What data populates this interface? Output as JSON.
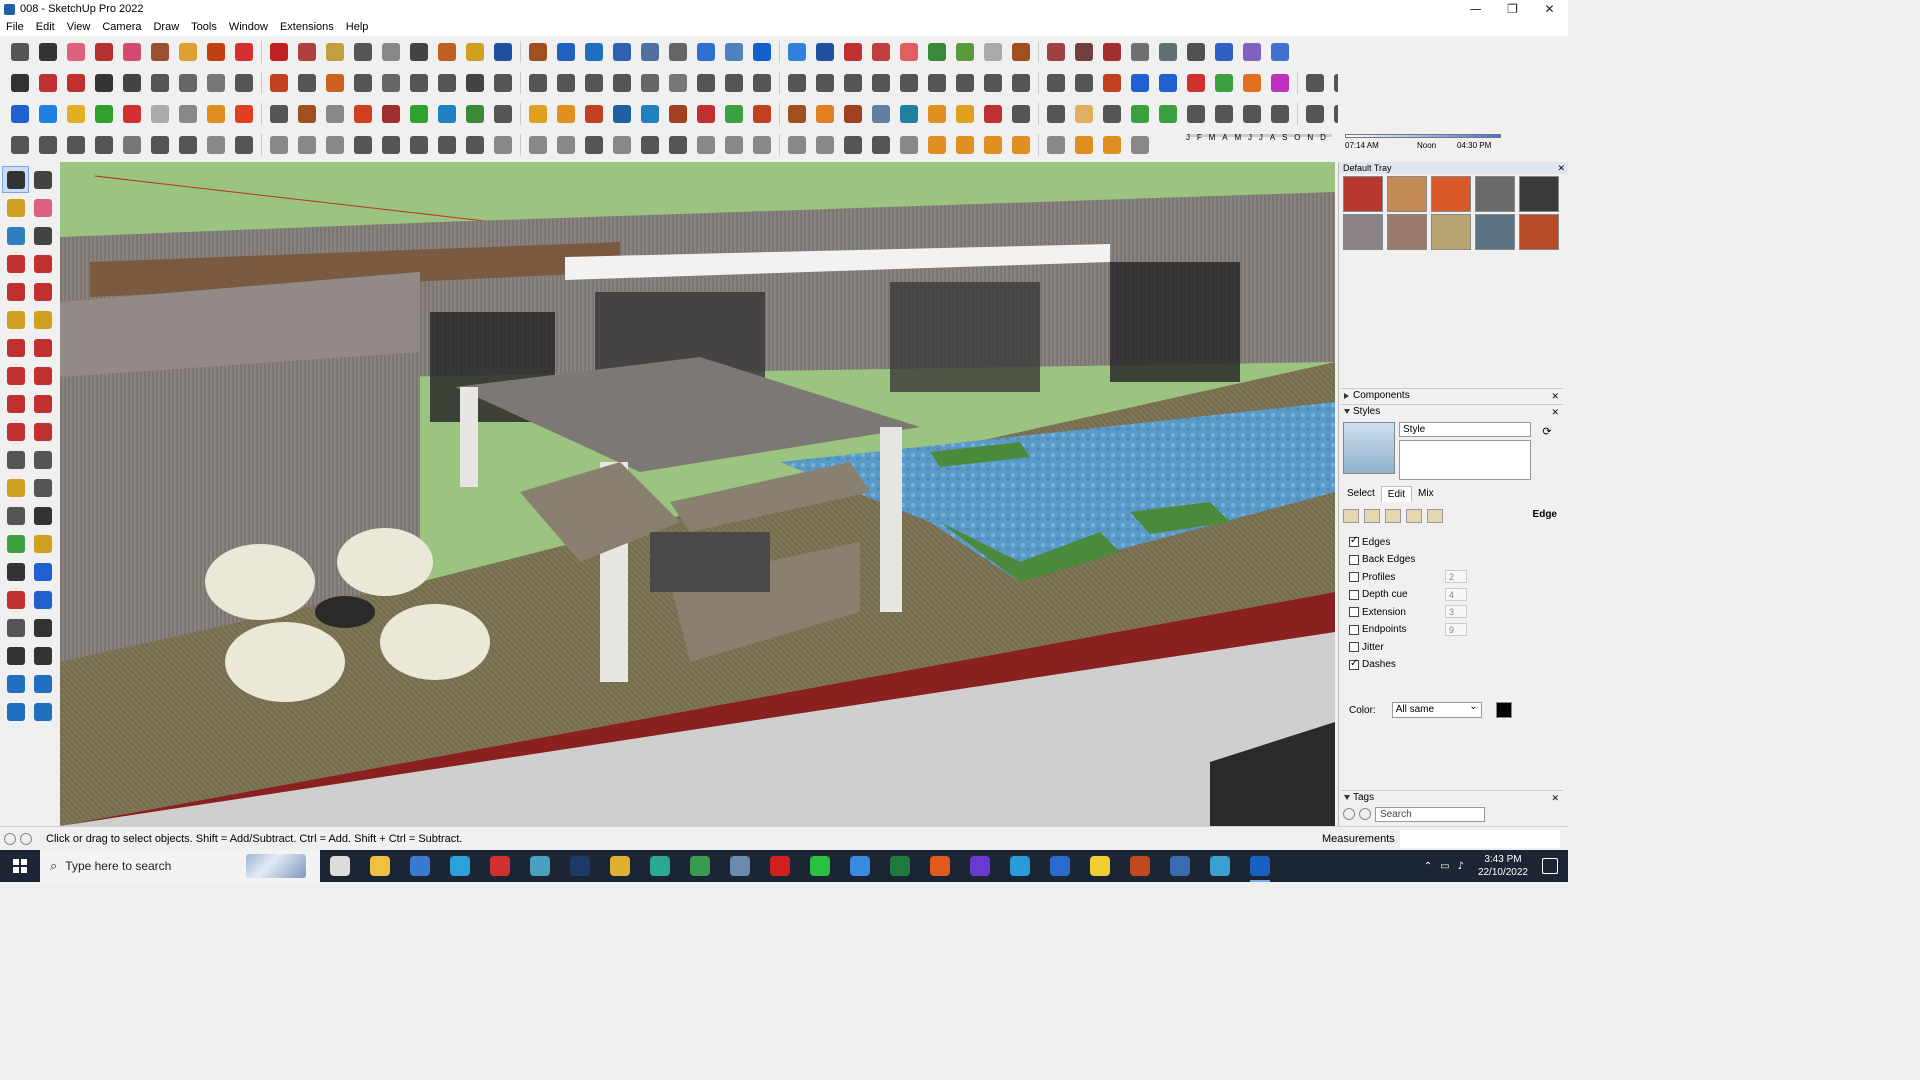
{
  "window": {
    "title": "008 - SketchUp Pro 2022",
    "buttons": [
      "—",
      "❐",
      "✕"
    ]
  },
  "menu": [
    "File",
    "Edit",
    "View",
    "Camera",
    "Draw",
    "Tools",
    "Window",
    "Extensions",
    "Help"
  ],
  "toolbar_icon_colors": {
    "row1": [
      "#555",
      "#333",
      "#e06080",
      "#b43030",
      "#d24a70",
      "#9a5030",
      "#e0a030",
      "#c04010",
      "#d23030",
      "#c02020",
      "#b04040",
      "#c0a040",
      "#555",
      "#888",
      "#444",
      "#c06020",
      "#d0a020",
      "#2050a0",
      "#a05020",
      "#2060c0",
      "#2070c0",
      "#3060b0",
      "#5070a0",
      "#666",
      "#3070d0",
      "#5080c0",
      "#1060d0",
      "#3080e0",
      "#2050a0",
      "#c03030",
      "#c04040",
      "#e06060",
      "#3a8a3a",
      "#5a9a3a",
      "#aaaaaa",
      "#a05020",
      "#a04040",
      "#704040",
      "#a03030",
      "#707070",
      "#607070",
      "#505050",
      "#3060c0",
      "#8060c0",
      "#4070d0"
    ],
    "row2": [
      "#333",
      "#c03030",
      "#c03030",
      "#333",
      "#444",
      "#555",
      "#666",
      "#777",
      "#555",
      "#c04020",
      "#555",
      "#d06020",
      "#555",
      "#666",
      "#555",
      "#555",
      "#444",
      "#555",
      "#555",
      "#555",
      "#555",
      "#555",
      "#666",
      "#777",
      "#555",
      "#555",
      "#555",
      "#555",
      "#555",
      "#555",
      "#555",
      "#555",
      "#555",
      "#555",
      "#555",
      "#555",
      "#555",
      "#555",
      "#c04020",
      "#2060d0",
      "#2060d0",
      "#d03030",
      "#3aa040",
      "#e07020",
      "#c030c0",
      "#555",
      "#555",
      "#333",
      "#555",
      "#555"
    ],
    "row3": [
      "#2060d0",
      "#2080e0",
      "#e0b020",
      "#30a030",
      "#d03030",
      "#aaaaaa",
      "#888",
      "#e09020",
      "#e04020",
      "#555",
      "#a05020",
      "#888",
      "#d04020",
      "#a03030",
      "#30a030",
      "#2080c0",
      "#3a8a3a",
      "#555",
      "#e0a020",
      "#e09020",
      "#c04020",
      "#2060a0",
      "#2080c0",
      "#a04020",
      "#c03030",
      "#3aa040",
      "#c04020",
      "#a05020",
      "#e08020",
      "#a04020",
      "#6080a0",
      "#2080a0",
      "#e09020",
      "#e0a020",
      "#c03030",
      "#555",
      "#555",
      "#e0b060",
      "#555",
      "#3aa040",
      "#3aa040",
      "#555",
      "#555",
      "#555",
      "#555",
      "#555",
      "#555",
      "#2060d0",
      "#555",
      "#e03030",
      "#e060a0"
    ],
    "row4": [
      "#555",
      "#555",
      "#555",
      "#555",
      "#777",
      "#555",
      "#555",
      "#888",
      "#555",
      "#888",
      "#888",
      "#888",
      "#555",
      "#555",
      "#555",
      "#555",
      "#555",
      "#888",
      "#888",
      "#888",
      "#555",
      "#888",
      "#555",
      "#555",
      "#888",
      "#888",
      "#888",
      "#888",
      "#888",
      "#555",
      "#555",
      "#888",
      "#e09020",
      "#e09020",
      "#e09020",
      "#e09020",
      "#888",
      "#e09020",
      "#e09020",
      "#888"
    ]
  },
  "shadow": {
    "months": [
      "J",
      "F",
      "M",
      "A",
      "M",
      "J",
      "J",
      "A",
      "S",
      "O",
      "N",
      "D"
    ],
    "time_start": "07:14 AM",
    "time_mid": "Noon",
    "time_end": "04:30 PM"
  },
  "left_tool_colors": [
    "#333",
    "#444",
    "#d0a020",
    "#e06080",
    "#3080c0",
    "#444",
    "#c03030",
    "#c03030",
    "#c03030",
    "#c03030",
    "#d0a020",
    "#d0a020",
    "#c03030",
    "#c03030",
    "#c03030",
    "#c03030",
    "#c03030",
    "#c03030",
    "#c03030",
    "#c03030",
    "#555",
    "#555",
    "#d0a020",
    "#555",
    "#555",
    "#333",
    "#3aa040",
    "#d0a020",
    "#333",
    "#2060d0",
    "#c03030",
    "#2060d0",
    "#555",
    "#333",
    "#333",
    "#333",
    "#2070c0",
    "#2070c0",
    "#2070c0",
    "#2070c0"
  ],
  "tray": {
    "title": "Default Tray",
    "materials": [
      "#b8382e",
      "#c48a55",
      "#d9582a",
      "#6a6a6a",
      "#3a3a3a",
      "#8a8285",
      "#9a7a6a",
      "#b9a572",
      "#5a7282",
      "#b84a28"
    ],
    "components_label": "Components",
    "styles_label": "Styles",
    "style_name": "Style",
    "tabs": [
      "Select",
      "Edit",
      "Mix"
    ],
    "edit_section": "Edge",
    "checkboxes": [
      {
        "label": "Edges",
        "checked": true,
        "value": ""
      },
      {
        "label": "Back Edges",
        "checked": false,
        "value": ""
      },
      {
        "label": "Profiles",
        "checked": false,
        "value": "2"
      },
      {
        "label": "Depth cue",
        "checked": false,
        "value": "4"
      },
      {
        "label": "Extension",
        "checked": false,
        "value": "3"
      },
      {
        "label": "Endpoints",
        "checked": false,
        "value": "9"
      },
      {
        "label": "Jitter",
        "checked": false,
        "value": ""
      },
      {
        "label": "Dashes",
        "checked": true,
        "value": ""
      }
    ],
    "color_label": "Color:",
    "color_option": "All same",
    "edge_color": "#000000",
    "tags_label": "Tags",
    "tags_search_placeholder": "Search"
  },
  "status": {
    "text": "Click or drag to select objects. Shift = Add/Subtract. Ctrl = Add. Shift + Ctrl = Subtract.",
    "measurements_label": "Measurements"
  },
  "taskbar": {
    "search_placeholder": "Type here to search",
    "apps": [
      {
        "name": "task-view-icon",
        "color": "#dddddd"
      },
      {
        "name": "file-explorer-icon",
        "color": "#f0c040"
      },
      {
        "name": "calculator-icon",
        "color": "#3a7ad0"
      },
      {
        "name": "edge-browser-icon",
        "color": "#2ca0d8"
      },
      {
        "name": "acrobat-icon",
        "color": "#d03030"
      },
      {
        "name": "snipping-tool-icon",
        "color": "#4aa0c0"
      },
      {
        "name": "photoshop-icon",
        "color": "#1e3a6a"
      },
      {
        "name": "chrome-icon",
        "color": "#e0b030"
      },
      {
        "name": "app-icon",
        "color": "#2aa890"
      },
      {
        "name": "chrome-icon-2",
        "color": "#3a9a50"
      },
      {
        "name": "app-icon-2",
        "color": "#6a8ab0"
      },
      {
        "name": "opera-icon",
        "color": "#d02020"
      },
      {
        "name": "whatsapp-icon",
        "color": "#2ac040"
      },
      {
        "name": "todo-icon",
        "color": "#3a8ae0"
      },
      {
        "name": "excel-icon",
        "color": "#1f7a40"
      },
      {
        "name": "grammarly-icon",
        "color": "#e05a20"
      },
      {
        "name": "app-icon-3",
        "color": "#6a3ad0"
      },
      {
        "name": "telegram-icon",
        "color": "#2a9ad8"
      },
      {
        "name": "app-icon-4",
        "color": "#2a6ad0"
      },
      {
        "name": "sticky-notes-icon",
        "color": "#f0d030"
      },
      {
        "name": "app-icon-5",
        "color": "#c04a20"
      },
      {
        "name": "app-icon-6",
        "color": "#3a6ab0"
      },
      {
        "name": "sketchup-layout-icon",
        "color": "#3aa0d0"
      },
      {
        "name": "sketchup-icon",
        "color": "#1a60c0"
      }
    ],
    "time": "3:43 PM",
    "date": "22/10/2022"
  }
}
